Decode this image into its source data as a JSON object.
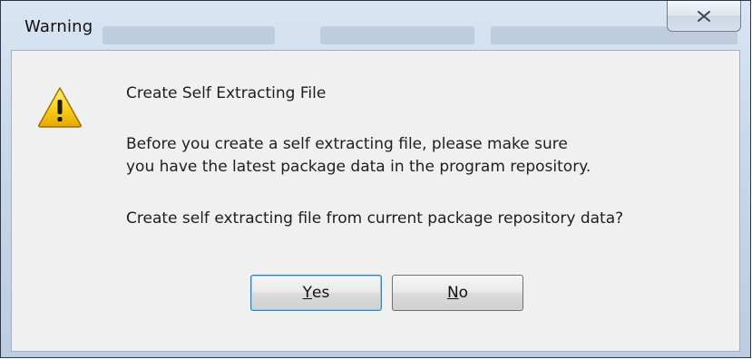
{
  "dialog": {
    "title": "Warning",
    "heading": "Create Self Extracting File",
    "message_line1": "Before you create a self extracting file, please make sure",
    "message_line2": "you have the latest package data in the program repository.",
    "question": "Create self extracting file from current package repository data?",
    "icon": "warning-icon",
    "close_icon": "close-icon"
  },
  "buttons": {
    "yes": {
      "accel": "Y",
      "rest": "es"
    },
    "no": {
      "accel": "N",
      "rest": "o"
    }
  },
  "colors": {
    "frame": "#c9d8ea",
    "content_bg": "#f0f0f0",
    "warning_yellow": "#f5c400"
  }
}
